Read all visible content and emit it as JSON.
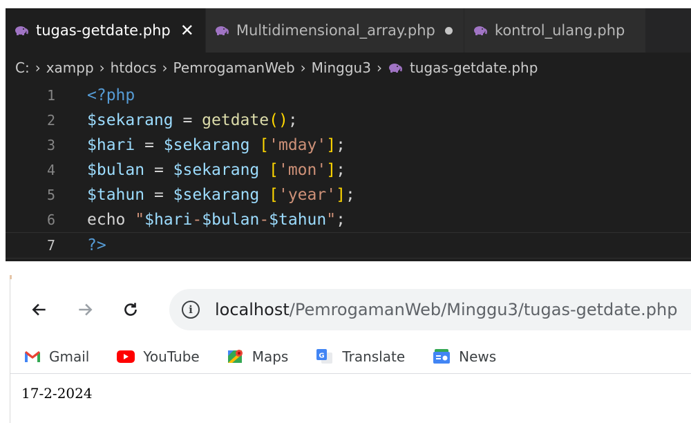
{
  "editor": {
    "tabs": [
      {
        "label": "tugas-getdate.php",
        "active": true,
        "close_glyph": "✕"
      },
      {
        "label": "Multidimensional_array.php",
        "active": false,
        "unsaved": true
      },
      {
        "label": "kontrol_ulang.php",
        "active": false
      }
    ],
    "breadcrumb": [
      "C:",
      "xampp",
      "htdocs",
      "PemrogamanWeb",
      "Minggu3",
      "tugas-getdate.php"
    ],
    "lines": [
      {
        "n": "1",
        "parts": [
          {
            "t": "<?php",
            "c": "tag"
          }
        ]
      },
      {
        "n": "2",
        "parts": [
          {
            "t": "$sekarang",
            "c": "var"
          },
          {
            "t": " = ",
            "c": "op"
          },
          {
            "t": "getdate",
            "c": "fn"
          },
          {
            "t": "()",
            "c": "bracket"
          },
          {
            "t": ";",
            "c": "op"
          }
        ]
      },
      {
        "n": "3",
        "parts": [
          {
            "t": "$hari",
            "c": "var"
          },
          {
            "t": " = ",
            "c": "op"
          },
          {
            "t": "$sekarang",
            "c": "var"
          },
          {
            "t": " ",
            "c": "op"
          },
          {
            "t": "[",
            "c": "bracket"
          },
          {
            "t": "'mday'",
            "c": "str"
          },
          {
            "t": "]",
            "c": "bracket"
          },
          {
            "t": ";",
            "c": "op"
          }
        ]
      },
      {
        "n": "4",
        "parts": [
          {
            "t": "$bulan",
            "c": "var"
          },
          {
            "t": " = ",
            "c": "op"
          },
          {
            "t": "$sekarang",
            "c": "var"
          },
          {
            "t": " ",
            "c": "op"
          },
          {
            "t": "[",
            "c": "bracket"
          },
          {
            "t": "'mon'",
            "c": "str"
          },
          {
            "t": "]",
            "c": "bracket"
          },
          {
            "t": ";",
            "c": "op"
          }
        ]
      },
      {
        "n": "5",
        "parts": [
          {
            "t": "$tahun",
            "c": "var"
          },
          {
            "t": " = ",
            "c": "op"
          },
          {
            "t": "$sekarang",
            "c": "var"
          },
          {
            "t": " ",
            "c": "op"
          },
          {
            "t": "[",
            "c": "bracket"
          },
          {
            "t": "'year'",
            "c": "str"
          },
          {
            "t": "]",
            "c": "bracket"
          },
          {
            "t": ";",
            "c": "op"
          }
        ]
      },
      {
        "n": "6",
        "parts": [
          {
            "t": "echo",
            "c": "plain"
          },
          {
            "t": " ",
            "c": "op"
          },
          {
            "t": "\"",
            "c": "str"
          },
          {
            "t": "$hari",
            "c": "var"
          },
          {
            "t": "-",
            "c": "str"
          },
          {
            "t": "$bulan",
            "c": "var"
          },
          {
            "t": "-",
            "c": "str"
          },
          {
            "t": "$tahun",
            "c": "var"
          },
          {
            "t": "\"",
            "c": "str"
          },
          {
            "t": ";",
            "c": "op"
          }
        ]
      },
      {
        "n": "7",
        "parts": [
          {
            "t": "?>",
            "c": "tag"
          }
        ],
        "current": true
      }
    ],
    "colors": {
      "background": "#1e1e1e",
      "tabbar": "#252526",
      "php_icon": "#a074c4"
    }
  },
  "browser": {
    "url_host": "localhost",
    "url_path": "/PemrogamanWeb/Minggu3/tugas-getdate.php",
    "bookmarks": [
      {
        "label": "Gmail",
        "icon": "gmail-icon"
      },
      {
        "label": "YouTube",
        "icon": "youtube-icon"
      },
      {
        "label": "Maps",
        "icon": "maps-icon"
      },
      {
        "label": "Translate",
        "icon": "translate-icon"
      },
      {
        "label": "News",
        "icon": "news-icon"
      }
    ],
    "page_output": "17-2-2024"
  }
}
